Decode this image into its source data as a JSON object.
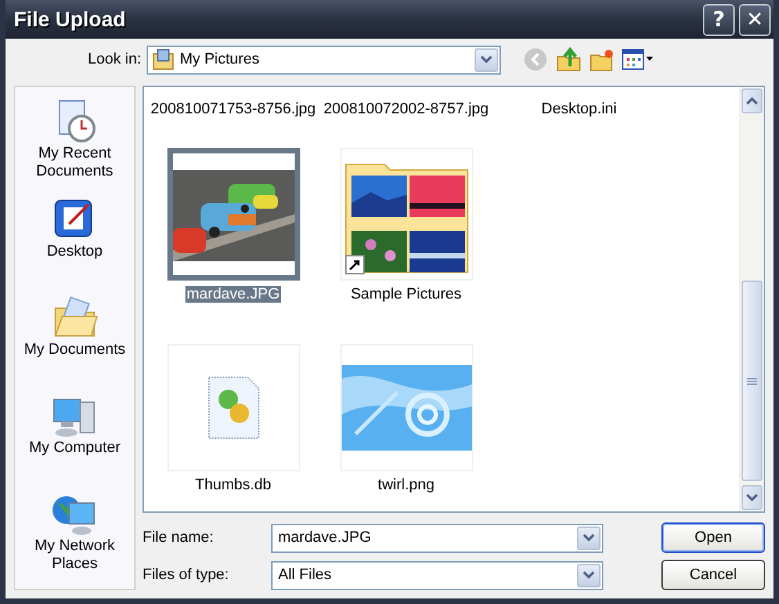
{
  "window": {
    "title": "File Upload",
    "buttons": [
      "?",
      "✕"
    ]
  },
  "look_in": {
    "label": "Look in:",
    "value": "My Pictures"
  },
  "places": [
    {
      "kind": "recent",
      "label": "My Recent Documents"
    },
    {
      "kind": "desktop",
      "label": "Desktop"
    },
    {
      "kind": "documents",
      "label": "My Documents"
    },
    {
      "kind": "computer",
      "label": "My Computer"
    },
    {
      "kind": "network",
      "label": "My Network Places"
    }
  ],
  "file_rows": [
    [
      {
        "kind": "name-only",
        "name": "200810071753-8756.jpg",
        "selected": false
      },
      {
        "kind": "name-only",
        "name": "200810072002-8757.jpg",
        "selected": false
      },
      {
        "kind": "name-only",
        "name": "Desktop.ini",
        "selected": false
      }
    ],
    [
      {
        "name": "mardave.JPG",
        "selected": true
      },
      {
        "kind": "folder",
        "name": "Sample Pictures",
        "selected": false
      }
    ],
    [
      {
        "kind": "file",
        "name": "Thumbs.db",
        "selected": false
      },
      {
        "name": "twirl.png",
        "selected": false
      }
    ]
  ],
  "file_name": {
    "label": "File name:",
    "value": "mardave.JPG"
  },
  "file_type": {
    "label": "Files of type:",
    "value": "All Files"
  },
  "buttons": [
    {
      "label": "Open",
      "default": true
    },
    {
      "label": "Cancel",
      "default": false
    }
  ]
}
